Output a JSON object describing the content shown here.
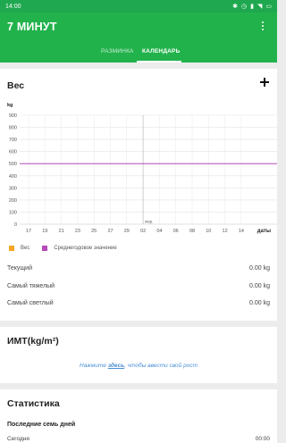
{
  "statusbar": {
    "time": "14:00",
    "icons": [
      "bluetooth-icon",
      "alarm-icon",
      "signal-icon",
      "wifi-icon",
      "battery-icon"
    ]
  },
  "appbar": {
    "title": "7 МИНУТ"
  },
  "tabs": [
    {
      "label": "РАЗМИНКА",
      "active": false
    },
    {
      "label": "КАЛЕНДАРЬ",
      "active": true
    }
  ],
  "weight": {
    "title": "Вес",
    "unit": "kg",
    "stats": [
      {
        "label": "Текущий",
        "value": "0.00 kg"
      },
      {
        "label": "Самый тяжелый",
        "value": "0.00 kg"
      },
      {
        "label": "Самый светлый",
        "value": "0.00 kg"
      }
    ]
  },
  "bmi": {
    "title": "ИМТ(kg/m²)",
    "link_before": "Нажмите ",
    "link_bold": "здесь",
    "link_after": ", чтобы ввести свой рост"
  },
  "stats": {
    "title": "Статистика",
    "subtitle": "Последние семь дней",
    "row_label": "Сегодня",
    "row_value": "00:00"
  },
  "chart_data": {
    "type": "line",
    "ylabel": "kg",
    "xlabel": "даты",
    "ylim": [
      0,
      900
    ],
    "yticks": [
      0,
      100,
      200,
      300,
      400,
      500,
      600,
      700,
      800,
      900
    ],
    "x": [
      "17",
      "19",
      "21",
      "23",
      "25",
      "27",
      "29",
      "02",
      "04",
      "06",
      "08",
      "10",
      "12",
      "14"
    ],
    "month_label": "мар.",
    "month_label_at": "02",
    "grid": true,
    "legend": "bottom-left",
    "series": [
      {
        "name": "Вес",
        "color": "#f6a623",
        "values": []
      },
      {
        "name": "Среднегодовое значение",
        "color": "#b54ab8",
        "values": [
          500,
          500,
          500,
          500,
          500,
          500,
          500,
          500,
          500,
          500,
          500,
          500,
          500,
          500
        ]
      }
    ]
  }
}
